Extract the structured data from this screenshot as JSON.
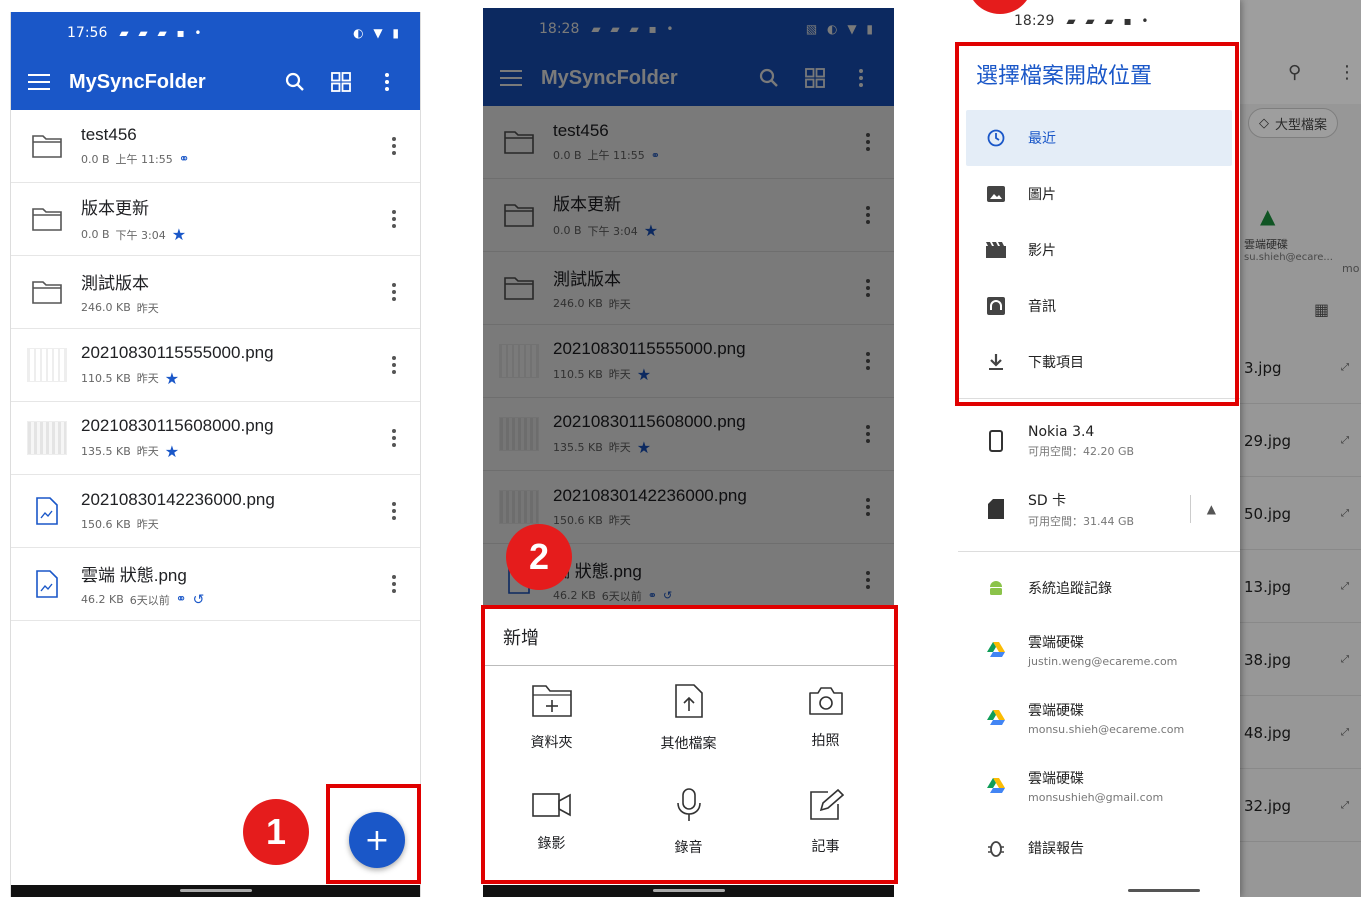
{
  "colors": {
    "brand": "#1a57c8",
    "highlight_box": "#e00000",
    "badge": "#e51c1c"
  },
  "phone1": {
    "status_time": "17:56",
    "app_title": "MySyncFolder",
    "files": [
      {
        "name": "test456",
        "size": "0.0 B",
        "time": "上午 11:55",
        "icon": "folder-icon",
        "marker": "link-icon"
      },
      {
        "name": "版本更新",
        "size": "0.0 B",
        "time": "下午 3:04",
        "icon": "folder-icon",
        "marker": "star-icon"
      },
      {
        "name": "測試版本",
        "size": "246.0 KB",
        "time": "昨天",
        "icon": "folder-icon",
        "marker": ""
      },
      {
        "name": "20210830115555000.png",
        "size": "110.5 KB",
        "time": "昨天",
        "icon": "image-thumb",
        "marker": "star-icon"
      },
      {
        "name": "20210830115608000.png",
        "size": "135.5 KB",
        "time": "昨天",
        "icon": "image-thumb",
        "marker": "star-icon"
      },
      {
        "name": "20210830142236000.png",
        "size": "150.6 KB",
        "time": "昨天",
        "icon": "image-file-icon",
        "marker": ""
      },
      {
        "name": "雲端 狀態.png",
        "size": "46.2 KB",
        "time": "6天以前",
        "icon": "image-file-icon",
        "marker": "link-history"
      }
    ],
    "fab_label": "+",
    "step": "1"
  },
  "phone2": {
    "status_time": "18:28",
    "app_title": "MySyncFolder",
    "files": [
      {
        "name": "test456",
        "size": "0.0 B",
        "time": "上午 11:55"
      },
      {
        "name": "版本更新",
        "size": "0.0 B",
        "time": "下午 3:04"
      },
      {
        "name": "測試版本",
        "size": "246.0 KB",
        "time": "昨天"
      },
      {
        "name": "20210830115555000.png",
        "size": "110.5 KB",
        "time": "昨天"
      },
      {
        "name": "20210830115608000.png",
        "size": "135.5 KB",
        "time": "昨天"
      },
      {
        "name": "20210830142236000.png",
        "size": "150.6 KB",
        "time": "昨天"
      },
      {
        "name": "端 狀態.png",
        "size": "46.2 KB",
        "time": "6天以前"
      }
    ],
    "sheet_title": "新增",
    "actions": [
      {
        "label": "資料夾",
        "icon": "new-folder-icon"
      },
      {
        "label": "其他檔案",
        "icon": "upload-file-icon"
      },
      {
        "label": "拍照",
        "icon": "camera-icon"
      },
      {
        "label": "錄影",
        "icon": "video-camera-icon"
      },
      {
        "label": "錄音",
        "icon": "microphone-icon"
      },
      {
        "label": "記事",
        "icon": "edit-note-icon"
      }
    ],
    "step": "2"
  },
  "phone3": {
    "status_time": "18:29",
    "drawer_title": "選擇檔案開啟位置",
    "recent": "最近",
    "images": "圖片",
    "videos": "影片",
    "audio": "音訊",
    "downloads": "下載項目",
    "device_name": "Nokia 3.4",
    "device_space": "可用空間：42.20 GB",
    "sd_name": "SD 卡",
    "sd_space": "可用空間：31.44 GB",
    "bug_report": "系統追蹤記錄",
    "drives": [
      {
        "name": "雲端硬碟",
        "account": "justin.weng@ecareme.com"
      },
      {
        "name": "雲端硬碟",
        "account": "monsu.shieh@ecareme.com"
      },
      {
        "name": "雲端硬碟",
        "account": "monsushieh@gmail.com"
      }
    ],
    "error_report": "錯誤報告",
    "bg_chip": "大型檔案",
    "bg_drive_label": "雲端硬碟",
    "bg_drive_account": "su.shieh@ecare...",
    "bg_more": "mo",
    "bg_files": [
      "3.jpg",
      "29.jpg",
      "50.jpg",
      "13.jpg",
      "38.jpg",
      "48.jpg",
      "32.jpg"
    ]
  }
}
